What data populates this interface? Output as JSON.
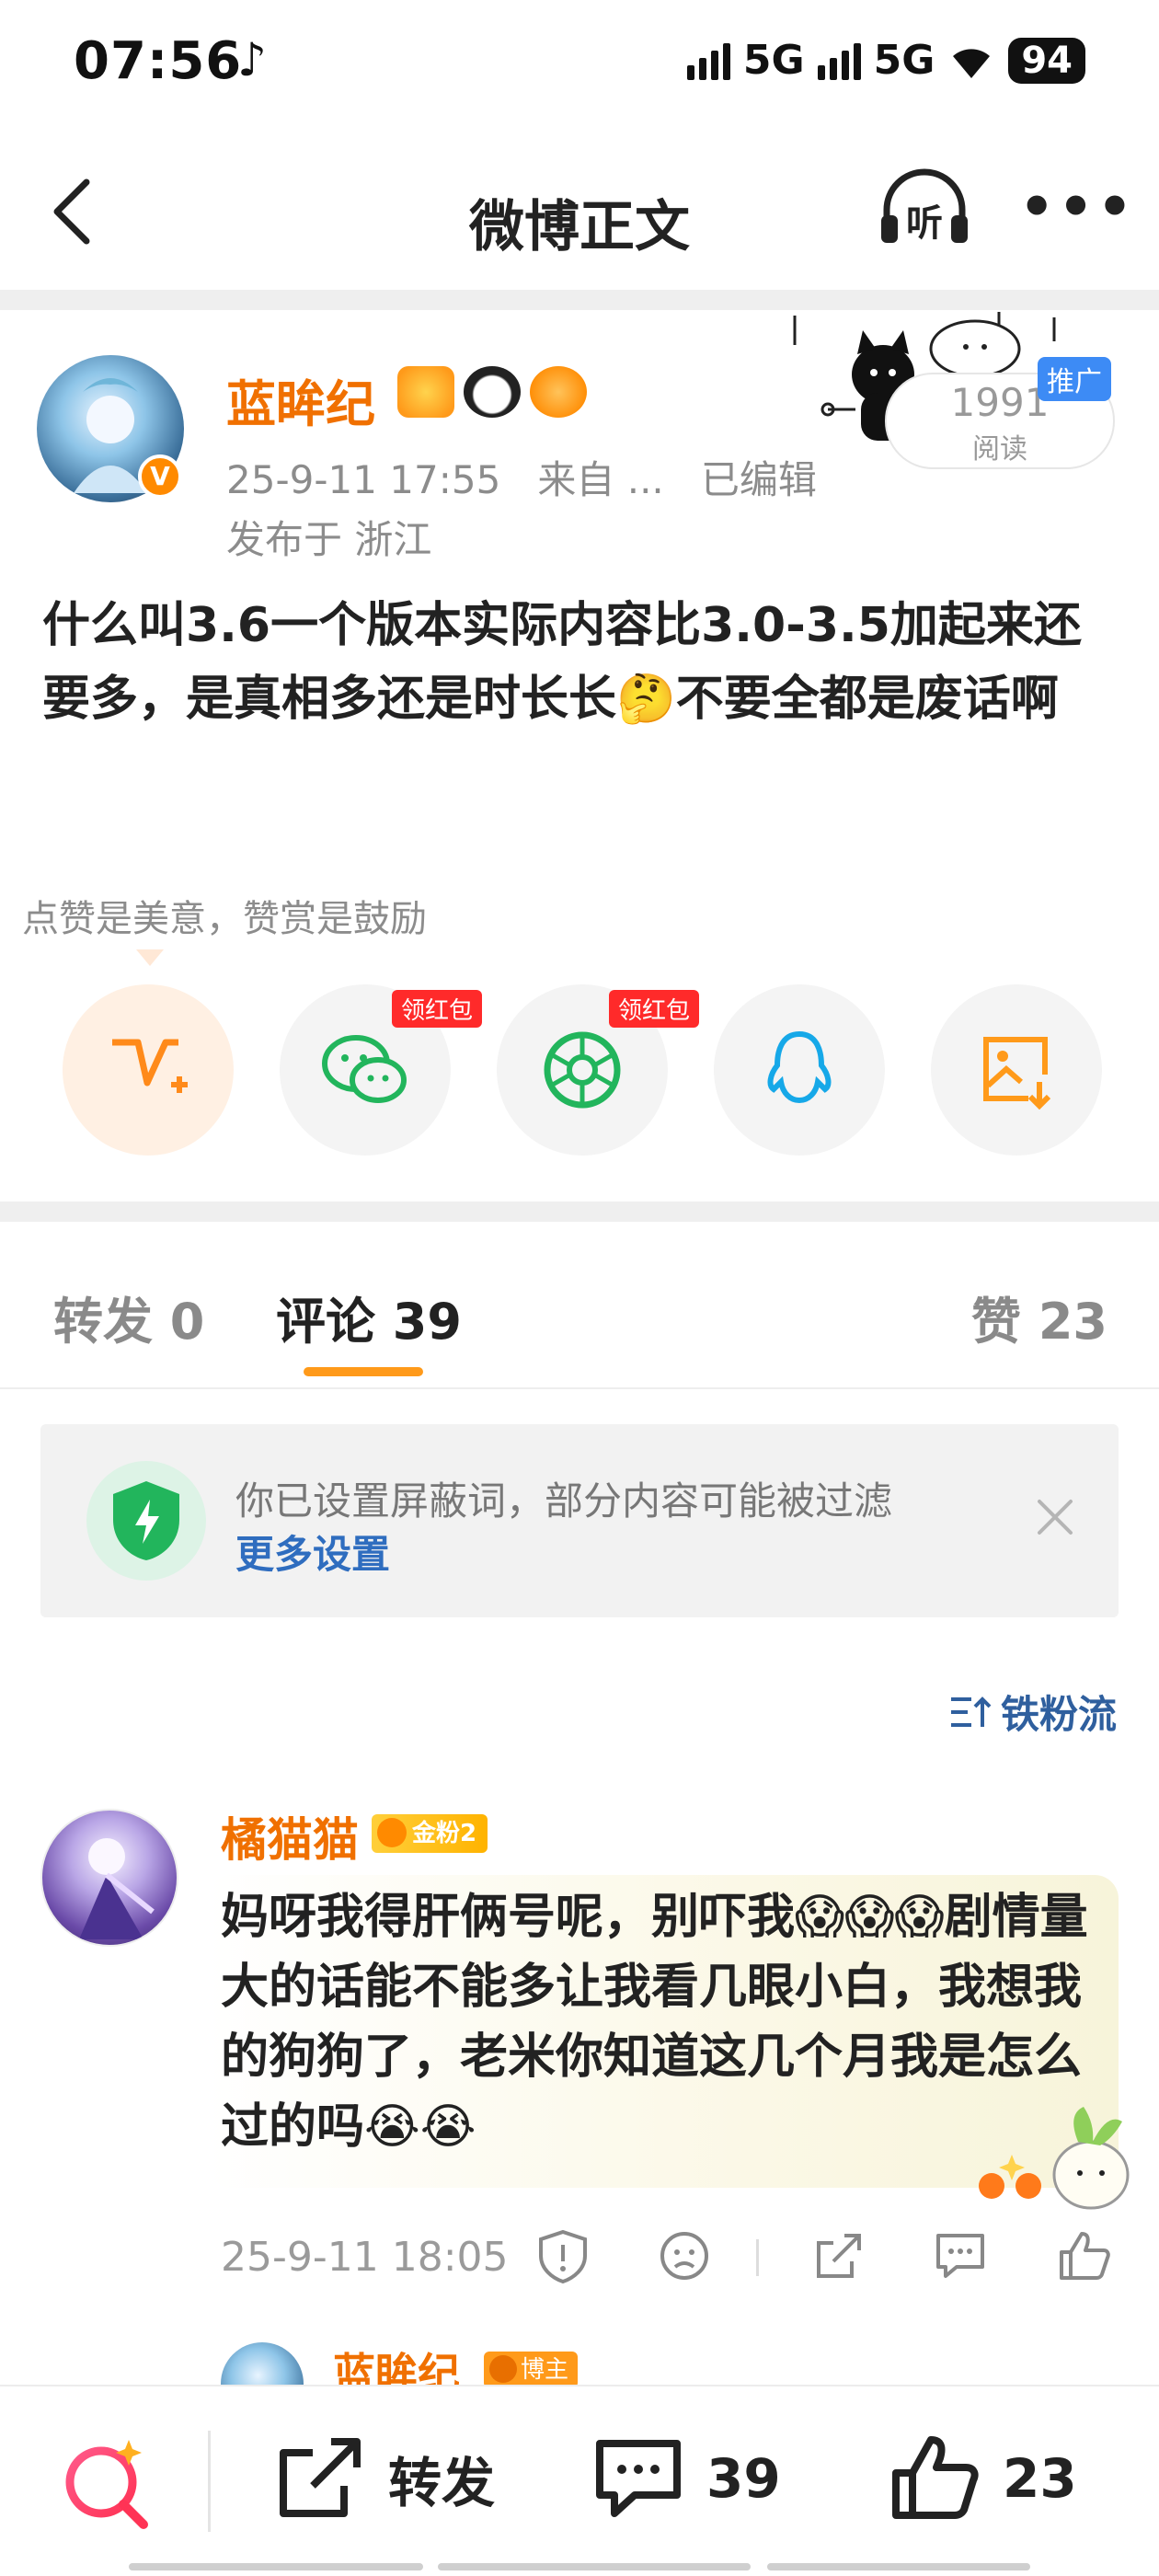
{
  "status_bar": {
    "time": "07:56",
    "network1": "5G",
    "network2": "5G",
    "battery": "94"
  },
  "nav": {
    "title": "微博正文"
  },
  "post": {
    "author": "蓝眸纪",
    "time": "25-9-11 17:55",
    "source": "来自 ...",
    "edited": "已编辑",
    "location": "发布于 浙江",
    "read_count": "1991",
    "read_label": "阅读",
    "promo_tag": "推广",
    "text": "什么叫3.6一个版本实际内容比3.0-3.5加起来还要多，是真相多还是时长长🤔不要全都是废话啊"
  },
  "reward": {
    "hint": "点赞是美意，赞赏是鼓励",
    "share_targets": [
      {
        "icon": "reward-v-icon",
        "tag": ""
      },
      {
        "icon": "wechat-icon",
        "tag": "领红包"
      },
      {
        "icon": "moments-icon",
        "tag": "领红包"
      },
      {
        "icon": "qq-icon",
        "tag": ""
      },
      {
        "icon": "save-image-icon",
        "tag": ""
      }
    ]
  },
  "tabs": {
    "repost": "转发 0",
    "comment": "评论 39",
    "like": "赞 23"
  },
  "notice": {
    "text": "你已设置屏蔽词，部分内容可能被过滤",
    "link": "更多设置"
  },
  "sort": {
    "label": "铁粉流"
  },
  "comment": {
    "author": "橘猫猫",
    "fan_badge": "金粉2",
    "text": "妈呀我得肝俩号呢，别吓我😱😱😱剧情量大的话能不能多让我看几眼小白，我想我的狗狗了，老米你知道这几个月我是怎么过的吗😭😭",
    "time": "25-9-11 18:05"
  },
  "reply": {
    "author": "蓝眸纪",
    "tag": "博主"
  },
  "bottom_bar": {
    "repost": "转发",
    "comments": "39",
    "likes": "23"
  },
  "colors": {
    "accent": "#f07000",
    "link": "#2f6dbf",
    "orange_bar": "#ff9a1a",
    "green": "#22b55c"
  }
}
